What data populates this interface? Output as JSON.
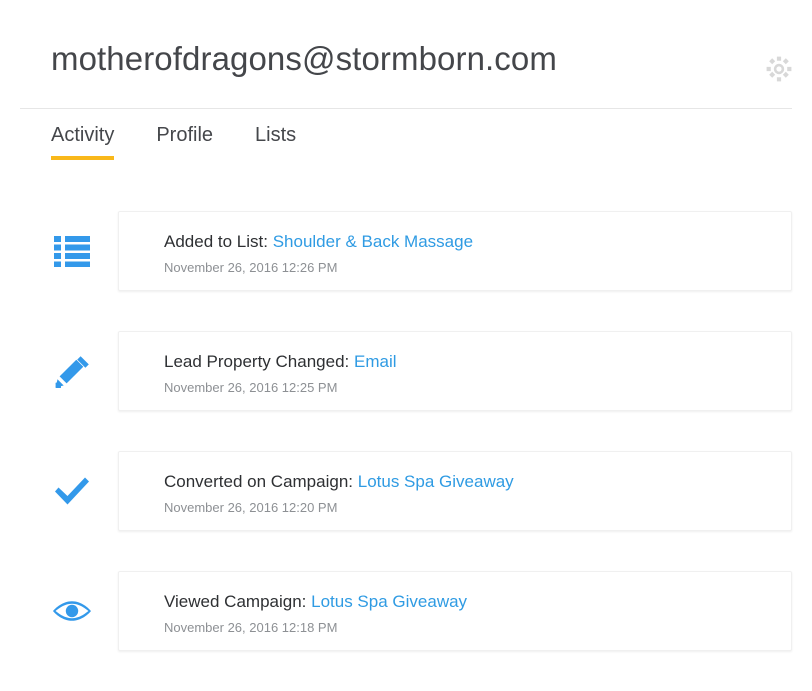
{
  "header": {
    "title": "motherofdragons@stormborn.com",
    "settings_icon": "gear-icon"
  },
  "tabs": [
    {
      "label": "Activity",
      "active": true
    },
    {
      "label": "Profile",
      "active": false
    },
    {
      "label": "Lists",
      "active": false
    }
  ],
  "colors": {
    "accent_underline": "#f9b81a",
    "link": "#2f9be3",
    "icon_blue": "#3399ea",
    "title_text": "#44464a",
    "timestamp_text": "#8d9094",
    "gear_gray": "#d8d8d8"
  },
  "activities": [
    {
      "icon": "list-icon",
      "label": "Added to List:",
      "link": "Shoulder & Back Massage",
      "timestamp": "November 26, 2016 12:26 PM"
    },
    {
      "icon": "pencil-icon",
      "label": "Lead Property Changed:",
      "link": "Email",
      "timestamp": "November 26, 2016 12:25 PM"
    },
    {
      "icon": "check-icon",
      "label": "Converted on Campaign:",
      "link": "Lotus Spa Giveaway",
      "timestamp": "November 26, 2016 12:20 PM"
    },
    {
      "icon": "eye-icon",
      "label": "Viewed Campaign:",
      "link": "Lotus Spa Giveaway",
      "timestamp": "November 26, 2016 12:18 PM"
    }
  ]
}
